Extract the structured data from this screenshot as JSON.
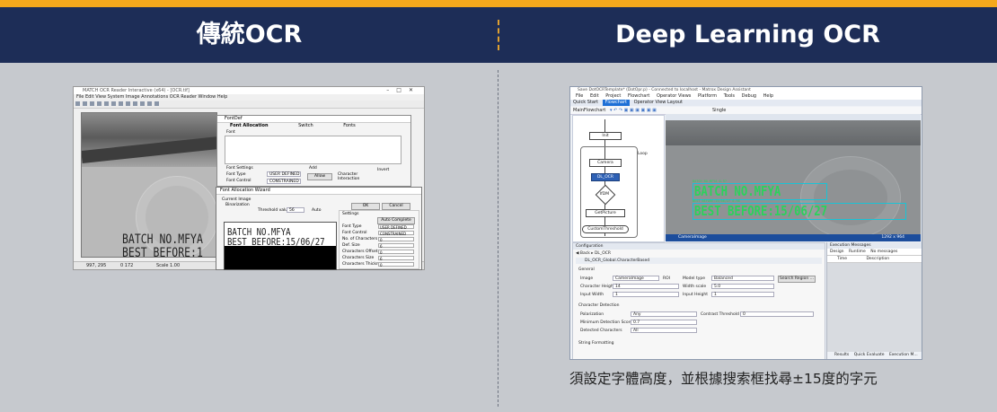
{
  "header": {
    "left_title": "傳統OCR",
    "right_title": "Deep Learning OCR"
  },
  "colors": {
    "accent_bar": "#f5a81c",
    "header_bg": "#1d2d57",
    "page_bg": "#c6c9ce",
    "ocr_text_green": "#2bd25b",
    "ocr_box_cyan": "#19c3d6"
  },
  "traditional_app": {
    "window_title": "MATCH OCR Reader Interactive (x64) - [OCR.tif]",
    "menu": "File  Edit  View  System  Image  Annotations  OCR Reader  Window  Help",
    "ocr_line1": "BATCH NO.MFYA",
    "ocr_line2": "BEST BEFORE:1",
    "status_coords": "997, 295",
    "status_pixel": "0 172",
    "status_scale": "Scale 1.00",
    "font_dialog": {
      "title": "FontDef",
      "tabs": [
        "Font Allocation",
        "Switch",
        "Fonts"
      ],
      "font_label": "Font",
      "font_settings_label": "Font Settings",
      "font_type_label": "Font Type",
      "font_type_value": "USER DEFINED",
      "font_control_label": "Font Control",
      "font_control_value": "CONSTRAINED",
      "add_label": "Add",
      "add_button": "Allow",
      "checkbox_label": "Character Interaction",
      "invert_label": "Invert"
    },
    "wizard": {
      "title": "Font Allocation Wizard",
      "current_image_label": "Current Image",
      "binarization_label": "Binarization",
      "threshold_label": "Threshold value",
      "threshold_value": "56",
      "auto_label": "Auto",
      "preview_line1": "BATCH NO.MFYA",
      "preview_line2": "BEST BEFORE:15/06/27",
      "ok_button": "OK",
      "cancel_button": "Cancel",
      "settings_label": "Settings",
      "auto_complete_button": "Auto Complete",
      "rows": [
        {
          "label": "Font Type",
          "value": "USER DEFINED"
        },
        {
          "label": "Font Control",
          "value": "CONSTRAINED"
        },
        {
          "label": "No. of Characters",
          "value": "0"
        },
        {
          "label": "Def. Size",
          "value": "6"
        },
        {
          "label": "Characters Offset",
          "value": "0"
        },
        {
          "label": "Characters Size",
          "value": "6"
        },
        {
          "label": "Characters Thickness",
          "value": "0"
        }
      ]
    }
  },
  "deep_learning_app": {
    "window_title": "Save DotOCRTemplate* (DotOpr.p) - Connected to localhost - Matrox Design Assistant",
    "menu": [
      "File",
      "Edit",
      "Project",
      "Flowchart",
      "Operator Views",
      "Platform",
      "Tools",
      "Debug",
      "Help"
    ],
    "tabs": [
      "Quick Start",
      "Flowchart",
      "Operator View Layout"
    ],
    "active_tab": "Flowchart",
    "toolbar_label": "MainFlowchart",
    "camera_toolbar_label": "Single",
    "flow_nodes": [
      "Init",
      "Camera",
      "DL_OCR",
      "IfDM",
      "GetPicture",
      "CustomThreshold"
    ],
    "flow_selected": "DL_OCR",
    "loop_label": "Loop",
    "ocr_line1": "BATCH NO.MFYA",
    "ocr_line2": "BEST BEFORE:15/06/27",
    "ocr_tag1": "BATCH NO.MFYA 0.97",
    "ocr_tag2": "BEST BEFORE:15/06/27 0.98",
    "camera_bar_label": "CameraImage",
    "camera_bar_res": "1292 x 964",
    "configuration": {
      "title": "Configuration",
      "back_label": "Back",
      "step_label": "DL_OCR",
      "path_label": "DL_OCR_Global.CharacterBased",
      "general_label": "General",
      "image_label": "Image",
      "image_value": "CameraImage",
      "roi_label": "ROI",
      "model_type_label": "Model type",
      "model_type_value": "Balanced",
      "search_region_button": "Search Region ...",
      "char_height_label": "Character Height",
      "char_height_value": "14",
      "width_scale_label": "Width scale",
      "width_scale_value": "5.0",
      "input_width_label": "Input Width",
      "input_width_value": "1",
      "input_height_label": "Input Height",
      "input_height_value": "1",
      "char_detection_label": "Character Detection",
      "polarization_label": "Polarization",
      "polarization_value": "Any",
      "contrast_label": "Contrast Threshold",
      "contrast_value": "0",
      "min_score_label": "Minimum Detection Score",
      "min_score_value": "0.7",
      "detected_chars_label": "Detected Characters",
      "detected_chars_value": "All",
      "string_format_label": "String Formatting"
    },
    "execution": {
      "title": "Execution Messages",
      "design_tab": "Design",
      "runtime_tab": "Runtime",
      "no_messages": "No messages",
      "col_time": "Time",
      "col_desc": "Description",
      "bottom_tabs": [
        "Results",
        "Quick Evaluate",
        "Execution M..."
      ]
    }
  },
  "caption": "須設定字體高度，並根據搜索框找尋±15度的字元"
}
